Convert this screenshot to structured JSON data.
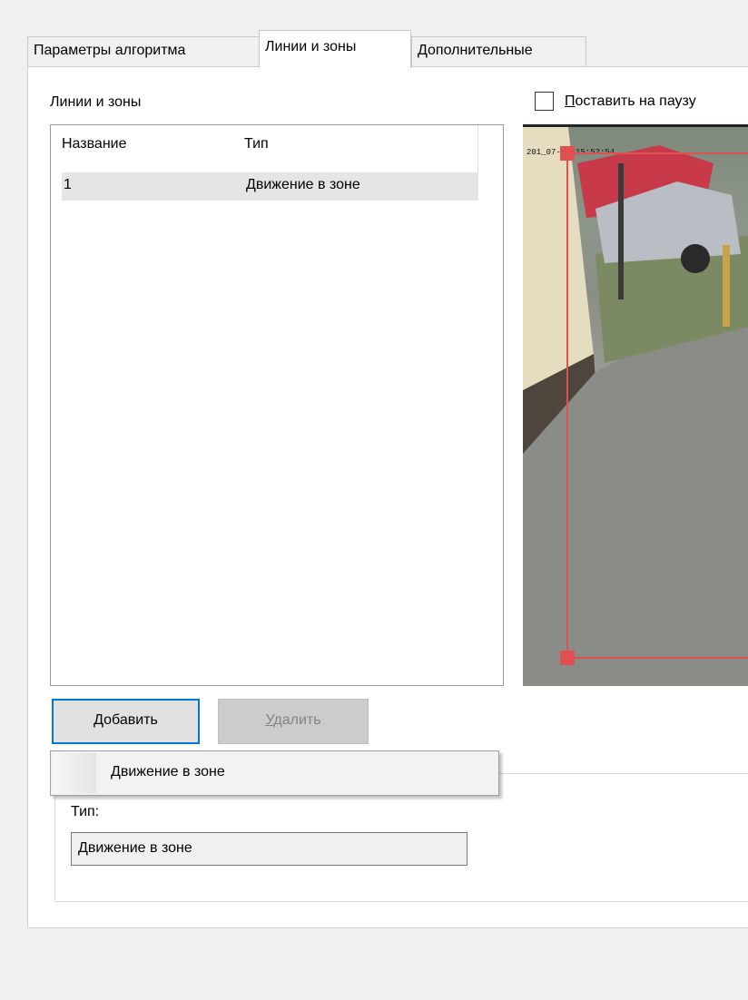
{
  "tabs": [
    {
      "label": "Параметры алгоритма"
    },
    {
      "label": "Линии и зоны"
    },
    {
      "label": "Дополнительные"
    }
  ],
  "lines_zones": {
    "group_label": "Линии и зоны",
    "columns": [
      "Название",
      "Тип"
    ],
    "rows": [
      {
        "name": "1",
        "type": "Движение в зоне"
      }
    ]
  },
  "pause": {
    "label_first": "П",
    "label_rest": "оставить на паузу",
    "checked": false
  },
  "video": {
    "timestamp": "201_07-2_ 15:52:54",
    "zone_color": "#e05050"
  },
  "buttons": {
    "add_first": "Д",
    "add_rest": "обавить",
    "delete_first": "У",
    "delete_rest": "далить"
  },
  "add_menu": {
    "items": [
      {
        "label": "Движение в зоне"
      }
    ]
  },
  "properties": {
    "type_label": "Тип:",
    "type_value": "Движение в зоне"
  }
}
